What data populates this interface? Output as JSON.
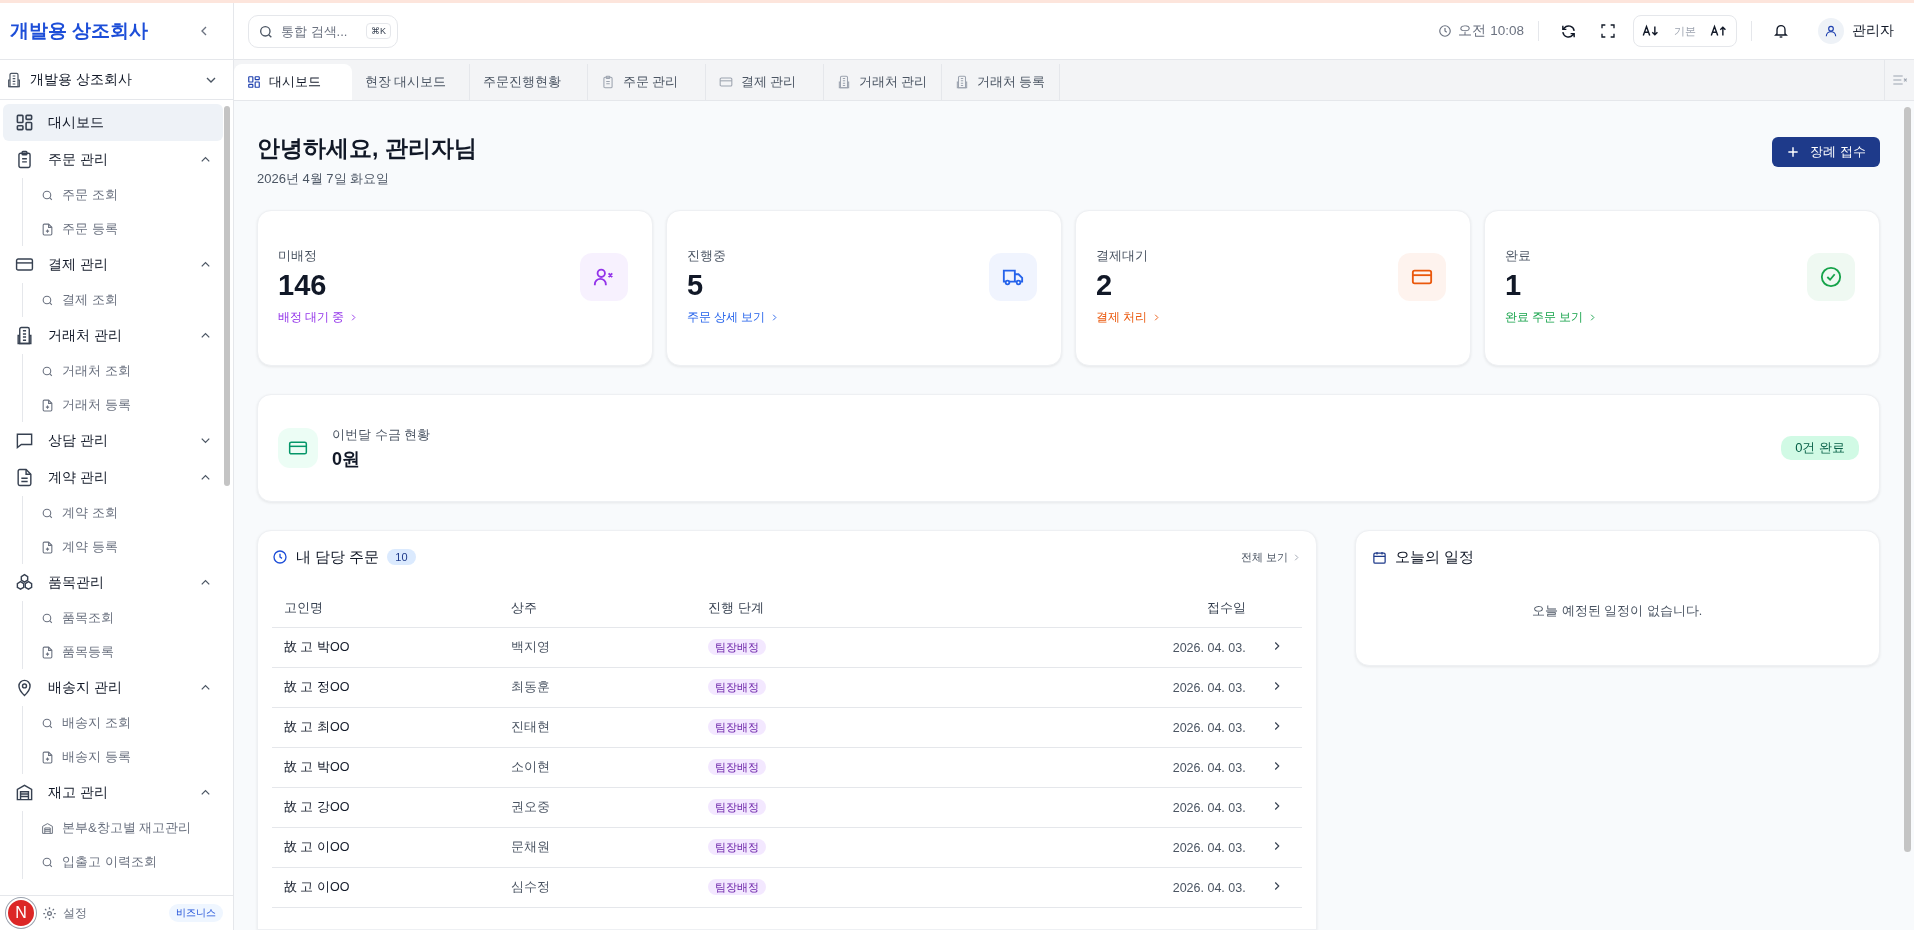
{
  "sidebar": {
    "brand": "개발용 상조회사",
    "workspace": "개발용 상조회사",
    "items": [
      {
        "label": "대시보드",
        "selected": true
      },
      {
        "label": "주문 관리",
        "selected": false,
        "expanded": true,
        "children": [
          {
            "label": "주문 조회",
            "kind": "view"
          },
          {
            "label": "주문 등록",
            "kind": "add"
          }
        ]
      },
      {
        "label": "결제 관리",
        "selected": false,
        "expanded": true,
        "children": [
          {
            "label": "결제 조회",
            "kind": "view"
          }
        ]
      },
      {
        "label": "거래처 관리",
        "selected": false,
        "expanded": true,
        "children": [
          {
            "label": "거래처 조회",
            "kind": "view"
          },
          {
            "label": "거래처 등록",
            "kind": "add"
          }
        ]
      },
      {
        "label": "상담 관리",
        "selected": false,
        "expanded": false
      },
      {
        "label": "계약 관리",
        "selected": false,
        "expanded": true,
        "children": [
          {
            "label": "계약 조회",
            "kind": "view"
          },
          {
            "label": "계약 등록",
            "kind": "add"
          }
        ]
      },
      {
        "label": "품목관리",
        "selected": false,
        "expanded": true,
        "children": [
          {
            "label": "품목조회",
            "kind": "view"
          },
          {
            "label": "품목등록",
            "kind": "add"
          }
        ]
      },
      {
        "label": "배송지 관리",
        "selected": false,
        "expanded": true,
        "children": [
          {
            "label": "배송지 조회",
            "kind": "view"
          },
          {
            "label": "배송지 등록",
            "kind": "add"
          }
        ]
      },
      {
        "label": "재고 관리",
        "selected": false,
        "expanded": true,
        "children": [
          {
            "label": "본부&창고별 재고관리",
            "kind": "stock"
          },
          {
            "label": "입출고 이력조회",
            "kind": "view"
          }
        ]
      }
    ],
    "settings": "설정",
    "plan_badge": "비즈니스",
    "avatar": "N"
  },
  "topbar": {
    "search": {
      "placeholder": "통합 검색...",
      "shortcut": "⌘K"
    },
    "time": "오전 10:08",
    "font_size": "기본",
    "user": "관리자"
  },
  "tabs": [
    {
      "label": "대시보드",
      "kind": "dashboard",
      "selected": true
    },
    {
      "label": "현장 대시보드",
      "kind": "plain",
      "selected": false
    },
    {
      "label": "주문진행현황",
      "kind": "plain",
      "selected": false
    },
    {
      "label": "주문 관리",
      "kind": "order",
      "selected": false
    },
    {
      "label": "결제 관리",
      "kind": "payment",
      "selected": false
    },
    {
      "label": "거래처 관리",
      "kind": "client",
      "selected": false
    },
    {
      "label": "거래처 등록",
      "kind": "client",
      "selected": false
    }
  ],
  "greeting": {
    "title": "안녕하세요, 관리자님",
    "date": "2026년 4월 7일 화요일",
    "action": "장례 접수"
  },
  "stats": [
    {
      "label": "미배정",
      "value": "146",
      "link": "배정 대기 중",
      "color": "#9333ea"
    },
    {
      "label": "진행중",
      "value": "5",
      "link": "주문 상세 보기",
      "color": "#2563eb"
    },
    {
      "label": "결제대기",
      "value": "2",
      "link": "결제 처리",
      "color": "#ea580c"
    },
    {
      "label": "완료",
      "value": "1",
      "link": "완료 주문 보기",
      "color": "#16a34a"
    }
  ],
  "collection": {
    "label": "이번달 수금 현황",
    "value": "0원",
    "badge": "0건 완료"
  },
  "my_orders": {
    "title": "내 담당 주문",
    "count": "10",
    "view_all": "전체 보기",
    "columns": [
      "고인명",
      "상주",
      "진행 단계",
      "접수일"
    ],
    "rows": [
      {
        "deceased": "故 고 박OO",
        "chief_mourner": "백지영",
        "stage": "팀장배정",
        "date": "2026. 04. 03."
      },
      {
        "deceased": "故 고 정OO",
        "chief_mourner": "최동훈",
        "stage": "팀장배정",
        "date": "2026. 04. 03."
      },
      {
        "deceased": "故 고 최OO",
        "chief_mourner": "진태현",
        "stage": "팀장배정",
        "date": "2026. 04. 03."
      },
      {
        "deceased": "故 고 박OO",
        "chief_mourner": "소이현",
        "stage": "팀장배정",
        "date": "2026. 04. 03."
      },
      {
        "deceased": "故 고 강OO",
        "chief_mourner": "권오중",
        "stage": "팀장배정",
        "date": "2026. 04. 03."
      },
      {
        "deceased": "故 고 이OO",
        "chief_mourner": "문채원",
        "stage": "팀장배정",
        "date": "2026. 04. 03."
      },
      {
        "deceased": "故 고 이OO",
        "chief_mourner": "심수정",
        "stage": "팀장배정",
        "date": "2026. 04. 03."
      }
    ]
  },
  "schedule": {
    "title": "오늘의 일정",
    "empty": "오늘 예정된 일정이 없습니다."
  }
}
